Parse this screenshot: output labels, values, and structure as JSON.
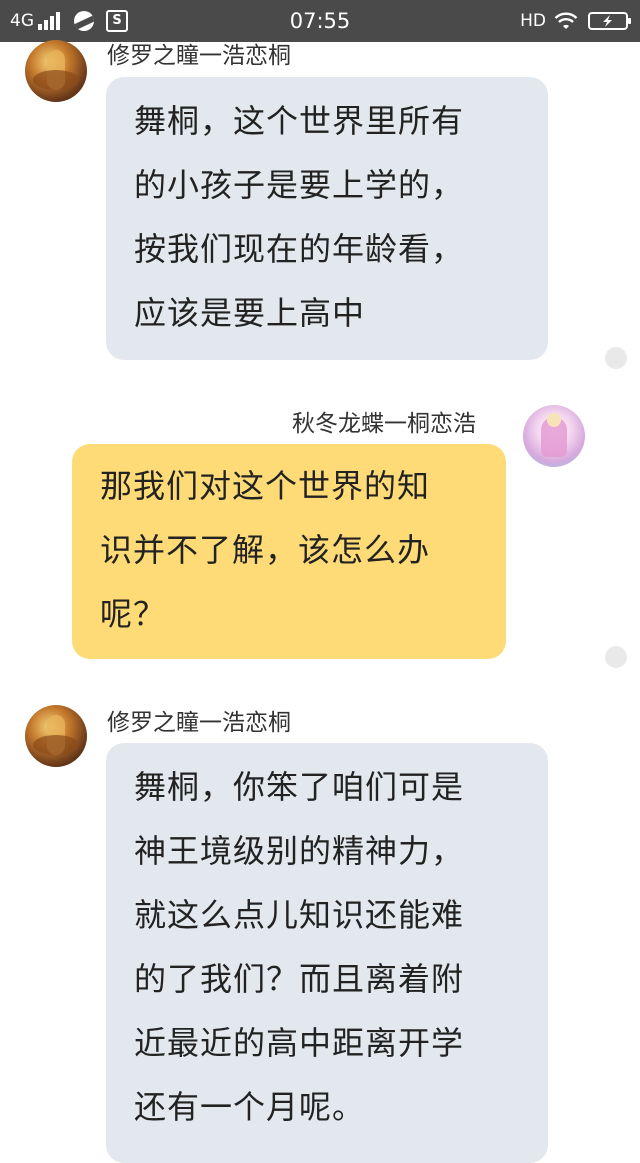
{
  "status_bar": {
    "network": "4G",
    "time": "07:55",
    "hd": "HD"
  },
  "messages": [
    {
      "sender": "修罗之瞳一浩恋桐",
      "side": "left",
      "lines": [
        "舞桐，这个世界里所有",
        "的小孩子是要上学的，",
        "按我们现在的年龄看，",
        "应该是要上高中"
      ]
    },
    {
      "sender": "秋冬龙蝶一桐恋浩",
      "side": "right",
      "lines": [
        "那我们对这个世界的知",
        "识并不了解，该怎么办",
        "呢？"
      ]
    },
    {
      "sender": "修罗之瞳一浩恋桐",
      "side": "left",
      "lines": [
        "舞桐，你笨了咱们可是",
        "神王境级别的精神力，",
        "就这么点儿知识还能难",
        "的了我们？而且离着附",
        "近最近的高中距离开学",
        "还有一个月呢。"
      ]
    }
  ],
  "colors": {
    "status_bar_bg": "#4a4a4a",
    "left_bubble_bg": "#e3e8ee",
    "right_bubble_bg": "#fedb76",
    "read_dot": "#e9e9e9"
  }
}
